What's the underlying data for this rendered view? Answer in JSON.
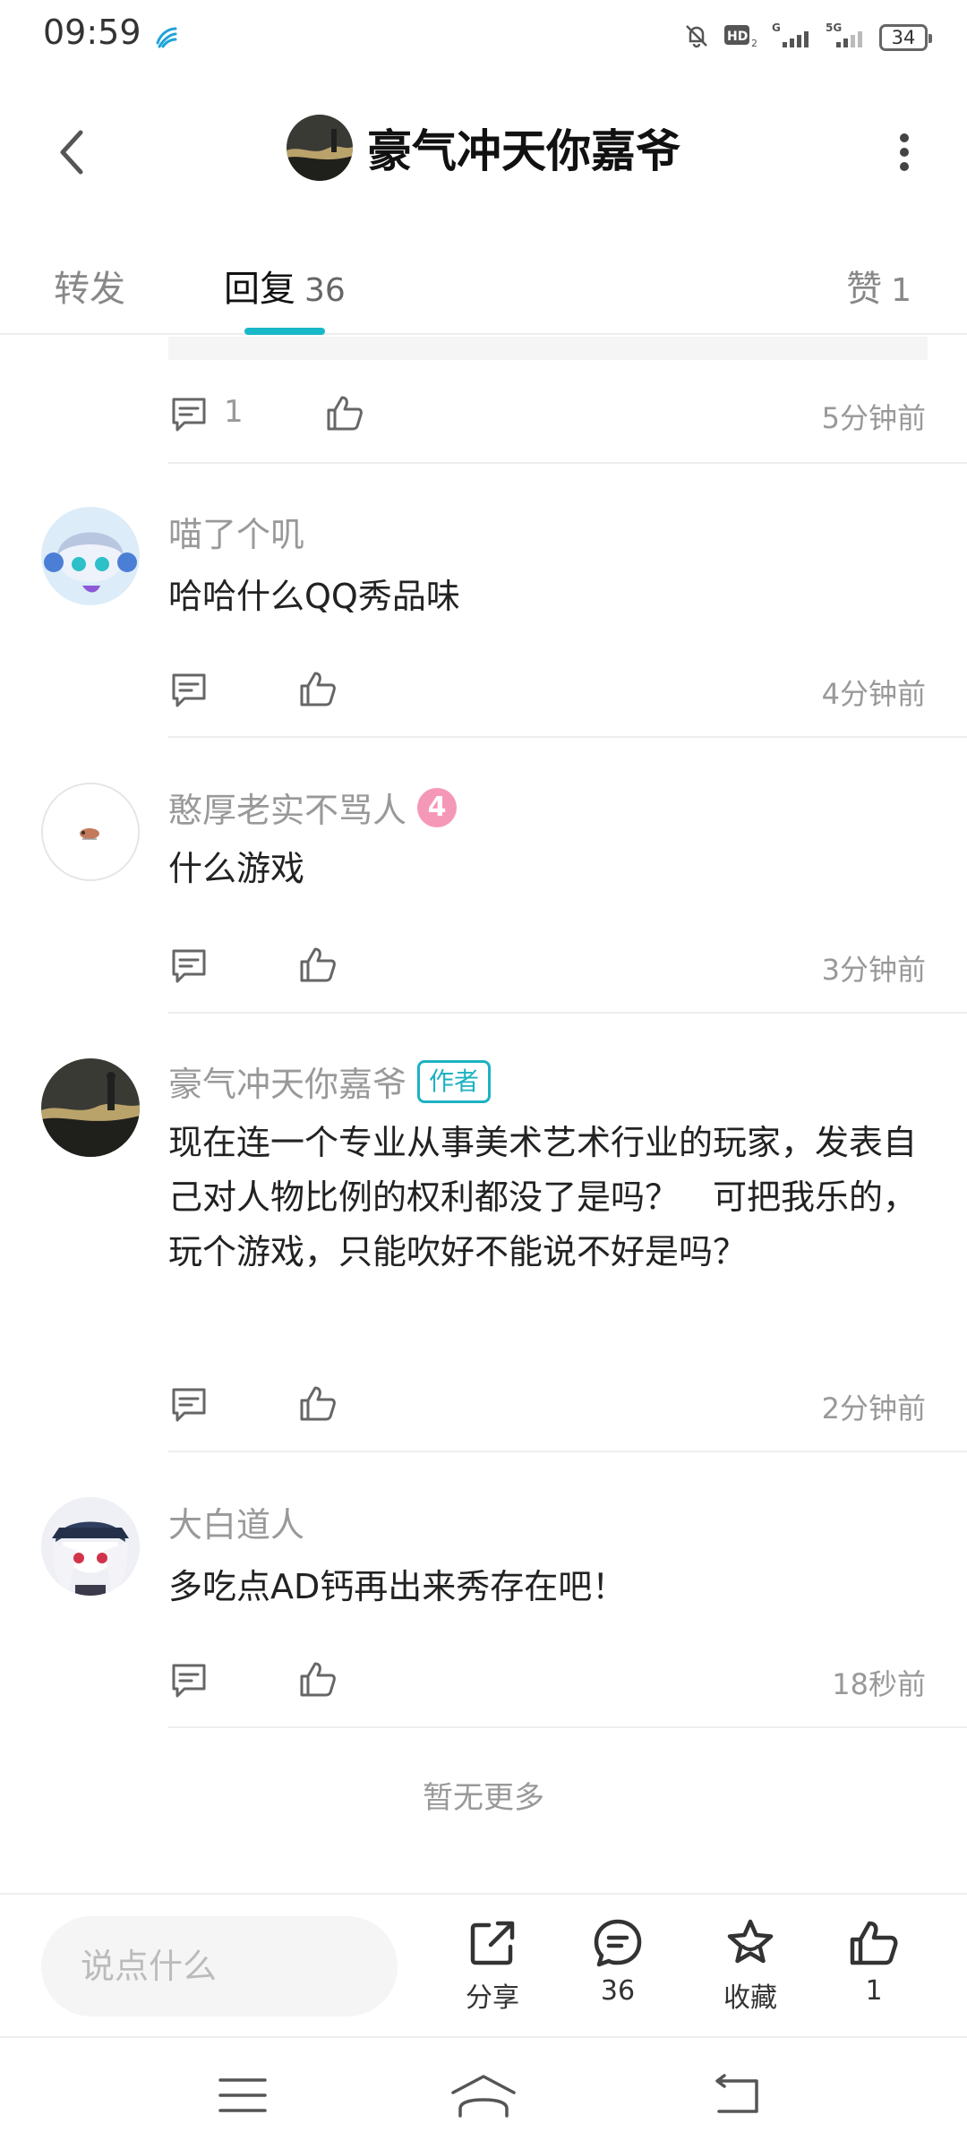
{
  "status_bar": {
    "time": "09:59",
    "battery": "34"
  },
  "header": {
    "title": "豪气冲天你嘉爷"
  },
  "tabs": {
    "forward": "转发",
    "reply": {
      "label": "回复",
      "count": "36"
    },
    "like": {
      "label": "赞",
      "count": "1"
    }
  },
  "top_item": {
    "reply_count": "1",
    "time": "5分钟前"
  },
  "comments": [
    {
      "username": "喵了个叽",
      "text": "哈哈什么QQ秀品味",
      "time": "4分钟前"
    },
    {
      "username": "憨厚老实不骂人",
      "level": "4",
      "text": "什么游戏",
      "time": "3分钟前"
    },
    {
      "username": "豪气冲天你嘉爷",
      "badge": "作者",
      "text": "现在连一个专业从事美术艺术行业的玩家，发表自己对人物比例的权利都没了是吗？　可把我乐的，玩个游戏，只能吹好不能说不好是吗？",
      "time": "2分钟前"
    },
    {
      "username": "大白道人",
      "text": "多吃点AD钙再出来秀存在吧！",
      "time": "18秒前"
    }
  ],
  "no_more": "暂无更多",
  "bottom_bar": {
    "input_placeholder": "说点什么",
    "share": "分享",
    "comments": "36",
    "favorite": "收藏",
    "likes": "1"
  },
  "colors": {
    "accent": "#18b8c8",
    "level_badge": "#f598b8"
  }
}
